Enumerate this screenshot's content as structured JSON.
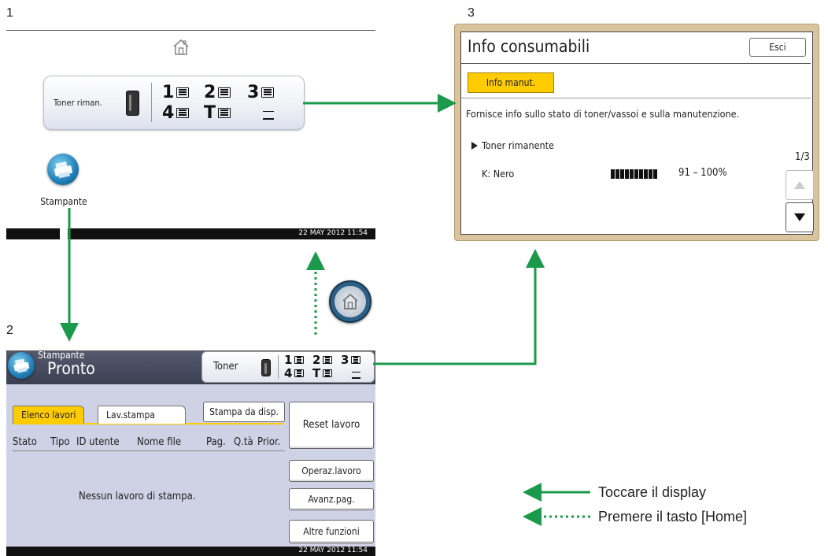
{
  "labels": {
    "panel1": "1",
    "panel2": "2",
    "panel3": "3"
  },
  "home_screen": {
    "toner_label": "Toner riman.",
    "trays": [
      "1",
      "2",
      "3",
      "4",
      "T"
    ],
    "app_label": "Stampante",
    "datetime": "22 MAY  2012 11:54"
  },
  "printer_screen": {
    "mode_label": "Stampante",
    "status": "Pronto",
    "toner_label": "Toner",
    "trays": [
      "1",
      "2",
      "3",
      "4",
      "T"
    ],
    "tabs": [
      "Elenco lavori",
      "Lav.stampa"
    ],
    "print_from_label": "Stampa da disp.",
    "reset_job_label": "Reset lavoro",
    "columns": [
      "Stato",
      "Tipo",
      "ID utente",
      "Nome file",
      "Pag.",
      "Q.tà",
      "Prior."
    ],
    "empty_message": "Nessun lavoro di stampa.",
    "side_buttons": [
      "Operaz.lavoro",
      "Avanz.pag.",
      "Altre funzioni"
    ],
    "datetime": "22 MAY  2012 11:54"
  },
  "consumables_screen": {
    "title": "Info consumabili",
    "exit_label": "Esci",
    "maint_label": "Info manut.",
    "description": "Fornisce info sullo stato di toner/vassoi e sulla manutenzione.",
    "section_label": "Toner rimanente",
    "page_indicator": "1/3",
    "toner_color_label": "K: Nero",
    "toner_level_text": "91 – 100%",
    "toner_level_fraction": 1.0
  },
  "legend": {
    "solid_label": "Toccare il display",
    "dotted_label": "Premere il tasto [Home]"
  },
  "colors": {
    "arrow": "#1a9a4a",
    "header": "#3b3f52",
    "accent": "#ffcc00",
    "frame": "#d9c49e"
  }
}
